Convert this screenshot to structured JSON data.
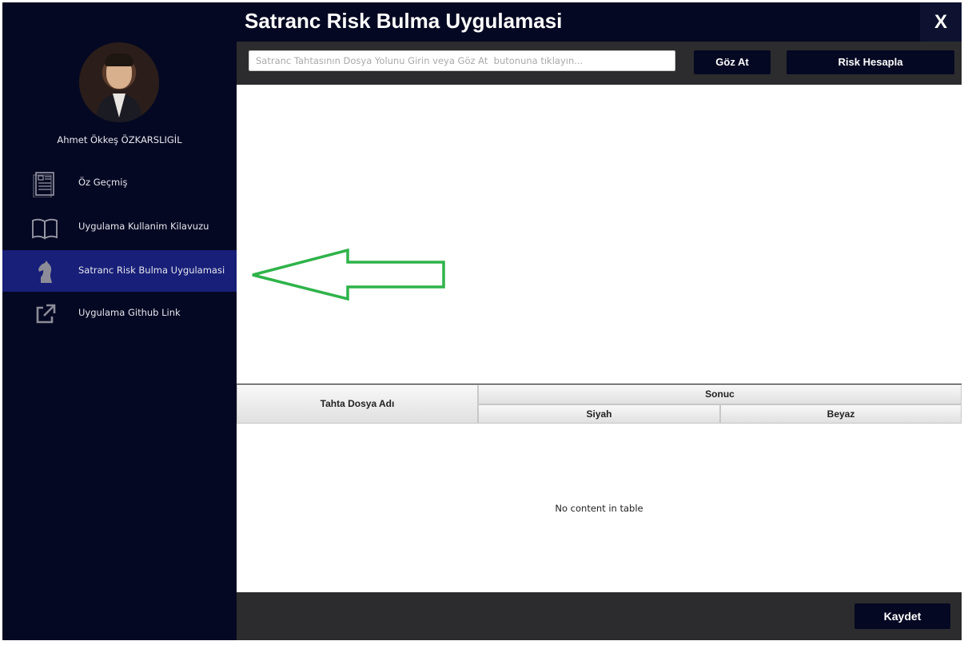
{
  "window": {
    "title": "Satranc Risk Bulma Uygulamasi",
    "close_label": "X"
  },
  "sidebar": {
    "user_name": "Ahmet Ökkeş ÖZKARSLIGİL",
    "items": [
      {
        "label": "Öz Geçmiş",
        "icon": "resume-icon",
        "active": false
      },
      {
        "label": "Uygulama Kullanim Kilavuzu",
        "icon": "book-icon",
        "active": false
      },
      {
        "label": "Satranc Risk Bulma Uygulamasi",
        "icon": "chess-knight-icon",
        "active": true
      },
      {
        "label": "Uygulama Github Link",
        "icon": "external-link-icon",
        "active": false
      }
    ]
  },
  "toolbar": {
    "path_value": "",
    "path_placeholder": "Satranc Tahtasının Dosya Yolunu Girin veya Göz At  butonuna tıklayın...",
    "browse_label": "Göz At",
    "risk_label": "Risk Hesapla"
  },
  "table": {
    "columns": {
      "file": "Tahta Dosya Adı",
      "result": "Sonuc",
      "black": "Siyah",
      "white": "Beyaz"
    },
    "rows": [],
    "empty_message": "No content in table"
  },
  "footer": {
    "save_label": "Kaydet"
  },
  "colors": {
    "sidebar_bg": "#050822",
    "active_item_bg": "#171f78",
    "toolbar_bg": "#2c2c2e",
    "button_bg": "#050822",
    "arrow": "#2fb34a"
  }
}
